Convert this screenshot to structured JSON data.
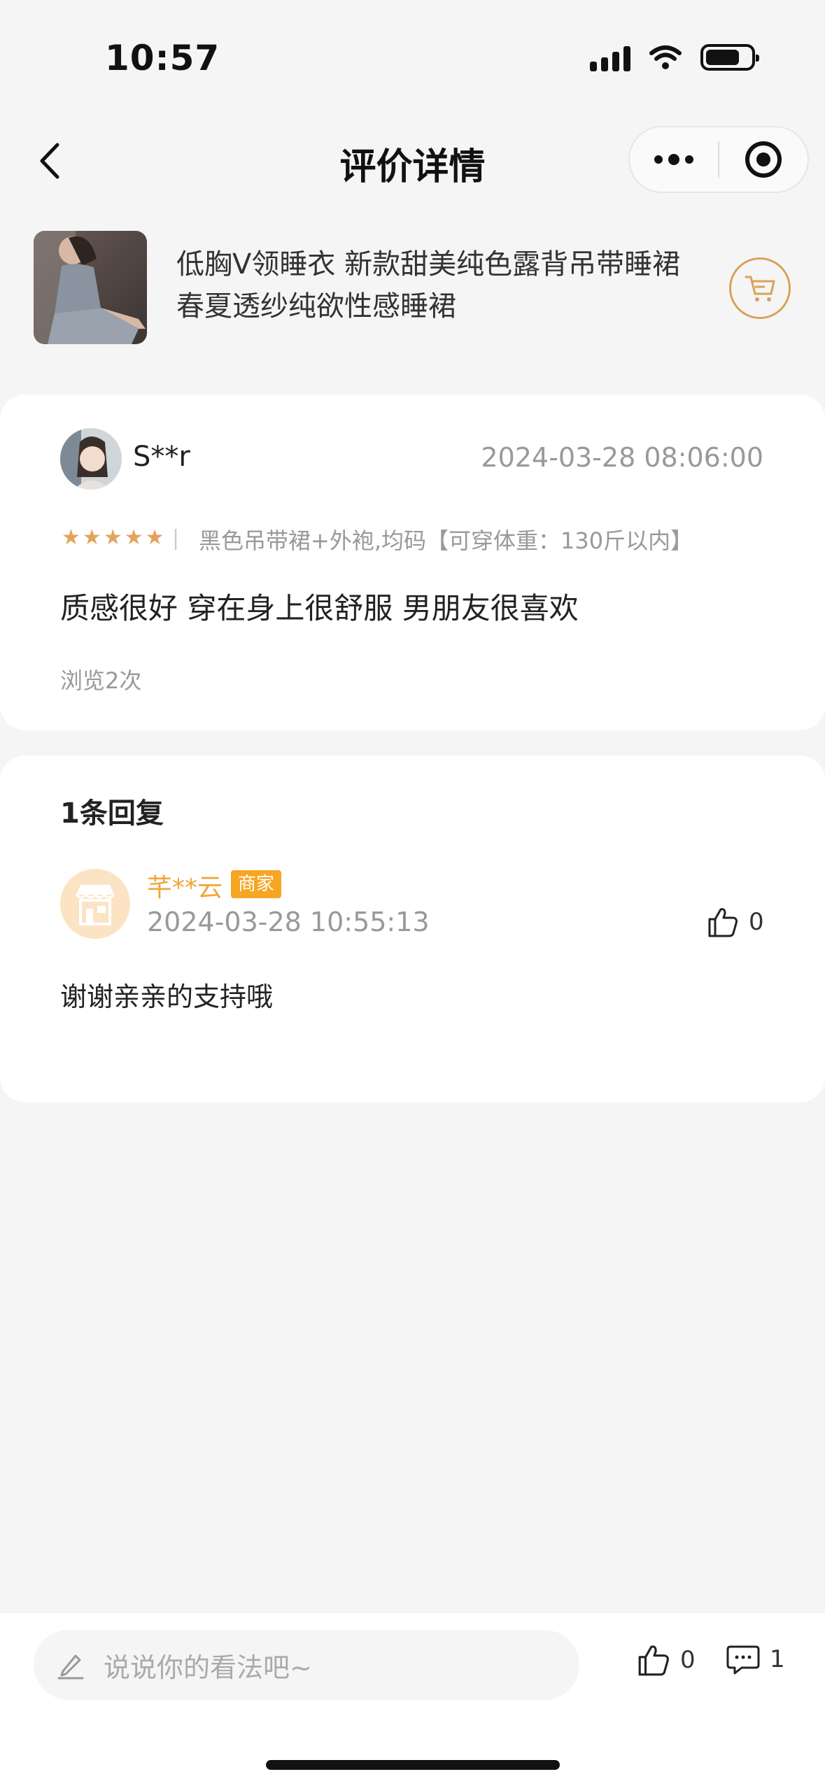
{
  "status_bar": {
    "time": "10:57"
  },
  "nav": {
    "title": "评价详情"
  },
  "product": {
    "title": "低胸V领睡衣 新款甜美纯色露背吊带睡裙春夏透纱纯欲性感睡裙"
  },
  "review": {
    "user_name": "S**r",
    "date": "2024-03-28 08:06:00",
    "rating": 5,
    "rating_max": 5,
    "separator": "|",
    "spec": "黑色吊带裙+外袍,均码【可穿体重：130斤以内】",
    "text": "质感很好 穿在身上很舒服 男朋友很喜欢",
    "views": "浏览2次"
  },
  "replies": {
    "count_label": "1条回复",
    "items": [
      {
        "name": "芊**云",
        "badge": "商家",
        "date": "2024-03-28 10:55:13",
        "likes": "0",
        "text": "谢谢亲亲的支持哦"
      }
    ]
  },
  "bottom_bar": {
    "placeholder": "说说你的看法吧~",
    "like_count": "0",
    "comment_count": "1"
  },
  "colors": {
    "accent": "#f5a623",
    "star": "#e3a35b",
    "merchant_name": "#f0a63a"
  }
}
